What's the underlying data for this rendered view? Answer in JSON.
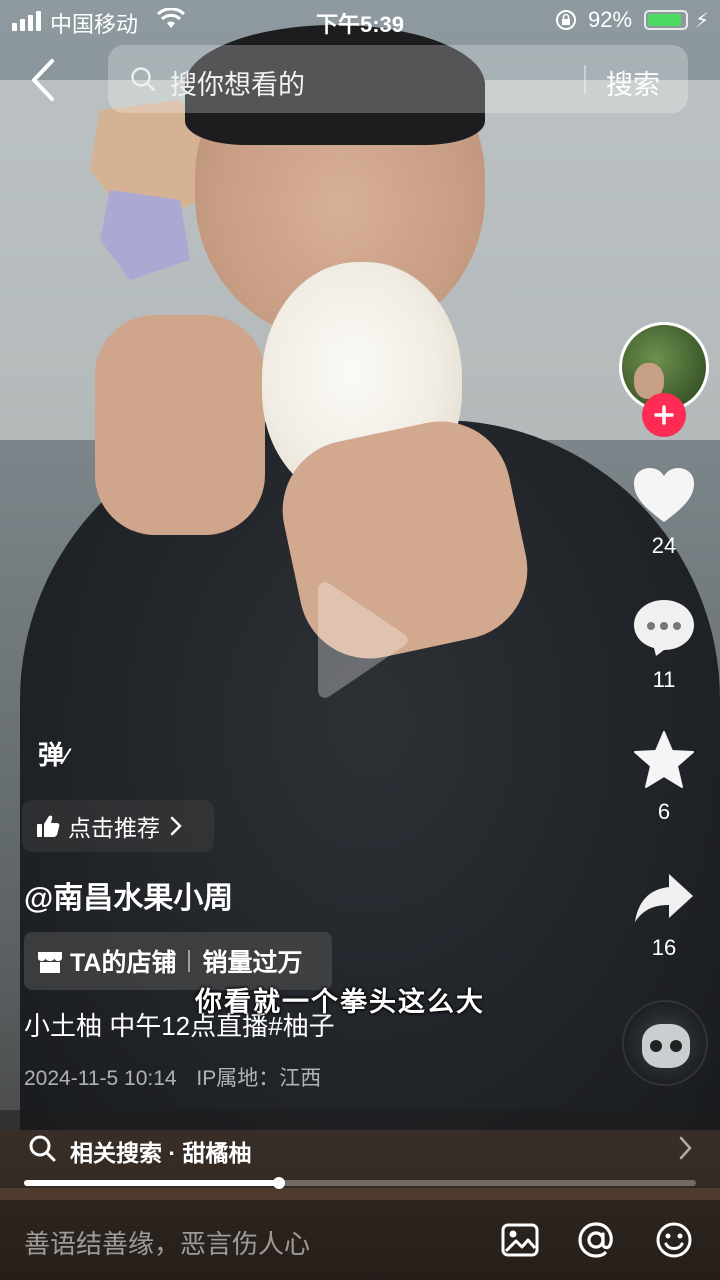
{
  "status_bar": {
    "carrier": "中国移动",
    "time": "下午5:39",
    "battery_percent": "92%",
    "battery_level": 0.92
  },
  "search": {
    "placeholder": "搜你想看的",
    "submit_label": "搜索"
  },
  "actions": {
    "like_count": "24",
    "comment_count": "11",
    "favorite_count": "6",
    "share_count": "16"
  },
  "video": {
    "danmaku_label": "弹",
    "recommend_label": "点击推荐",
    "author": "@南昌水果小周",
    "shop_label": "TA的店铺",
    "shop_sales": "销量过万",
    "caption": "小土柚 中午12点直播#柚子",
    "subtitle": "你看就一个拳头这么大",
    "date": "2024-11-5 10:14",
    "ip_location": "IP属地：江西"
  },
  "related_search": {
    "label": "相关搜索 · 甜橘柚"
  },
  "progress": {
    "fraction": 0.38
  },
  "comment": {
    "placeholder": "善语结善缘，恶言伤人心"
  },
  "colors": {
    "accent": "#fe2c55",
    "battery": "#4cd964"
  },
  "icons": [
    "back-icon",
    "search-icon",
    "heart-icon",
    "comment-icon",
    "star-icon",
    "share-icon",
    "play-icon",
    "thumbs-up-icon",
    "store-icon",
    "image-icon",
    "at-icon",
    "emoji-icon",
    "chevron-right-icon"
  ]
}
